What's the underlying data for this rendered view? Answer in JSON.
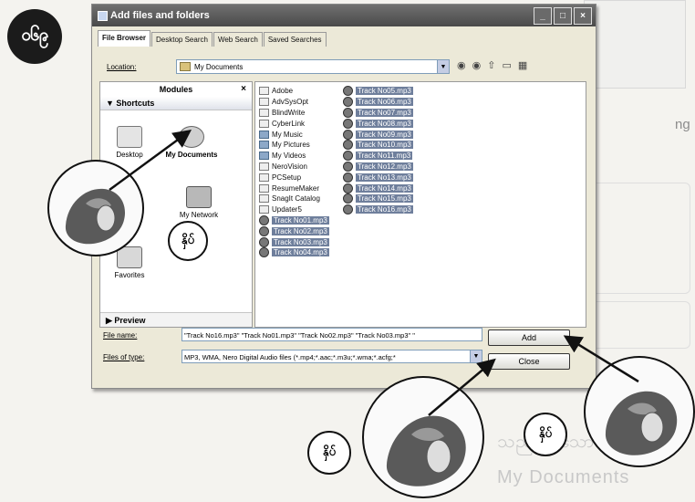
{
  "badge": {
    "text": "ဝ၆၉"
  },
  "page_bg": {
    "side_text": "ng",
    "bottom_line_1": "သည်ဖြစ်သော",
    "bottom_line_2": "My Documents"
  },
  "dialog": {
    "title": "Add files and folders",
    "tabs": [
      {
        "label": "File Browser"
      },
      {
        "label": "Desktop Search"
      },
      {
        "label": "Web Search"
      },
      {
        "label": "Saved Searches"
      }
    ],
    "location_label": "Location:",
    "location_value": "My Documents",
    "modules": {
      "title": "Modules",
      "close": "×",
      "shortcuts_label": "Shortcuts",
      "items": [
        {
          "label": "Desktop"
        },
        {
          "label": "My Documents"
        },
        {
          "label": "My Network"
        },
        {
          "label": "Favorites"
        }
      ],
      "preview_label": "Preview"
    },
    "files_col1": [
      {
        "name": "Adobe",
        "kind": "folder"
      },
      {
        "name": "AdvSysOpt",
        "kind": "folder"
      },
      {
        "name": "BlindWrite",
        "kind": "folder"
      },
      {
        "name": "CyberLink",
        "kind": "folder"
      },
      {
        "name": "My Music",
        "kind": "media"
      },
      {
        "name": "My Pictures",
        "kind": "media"
      },
      {
        "name": "My Videos",
        "kind": "media"
      },
      {
        "name": "NeroVision",
        "kind": "folder"
      },
      {
        "name": "PCSetup",
        "kind": "folder"
      },
      {
        "name": "ResumeMaker",
        "kind": "folder"
      },
      {
        "name": "SnagIt Catalog",
        "kind": "folder"
      },
      {
        "name": "Updater5",
        "kind": "folder"
      },
      {
        "name": "Track No01.mp3",
        "kind": "mp3"
      },
      {
        "name": "Track No02.mp3",
        "kind": "mp3"
      },
      {
        "name": "Track No03.mp3",
        "kind": "mp3"
      },
      {
        "name": "Track No04.mp3",
        "kind": "mp3"
      }
    ],
    "files_col2": [
      {
        "name": "Track No05.mp3",
        "kind": "mp3"
      },
      {
        "name": "Track No06.mp3",
        "kind": "mp3"
      },
      {
        "name": "Track No07.mp3",
        "kind": "mp3"
      },
      {
        "name": "Track No08.mp3",
        "kind": "mp3"
      },
      {
        "name": "Track No09.mp3",
        "kind": "mp3"
      },
      {
        "name": "Track No10.mp3",
        "kind": "mp3"
      },
      {
        "name": "Track No11.mp3",
        "kind": "mp3"
      },
      {
        "name": "Track No12.mp3",
        "kind": "mp3"
      },
      {
        "name": "Track No13.mp3",
        "kind": "mp3"
      },
      {
        "name": "Track No14.mp3",
        "kind": "mp3"
      },
      {
        "name": "Track No15.mp3",
        "kind": "mp3"
      },
      {
        "name": "Track No16.mp3",
        "kind": "mp3"
      }
    ],
    "filename_label": "File name:",
    "filename_value": "\"Track No16.mp3\" \"Track No01.mp3\" \"Track No02.mp3\" \"Track No03.mp3\" \"",
    "filetype_label": "Files of type:",
    "filetype_value": "MP3, WMA, Nero Digital Audio files (*.mp4;*.aac;*.m3u;*.wma;*.acfg;*",
    "add_button": "Add",
    "close_button": "Close"
  },
  "annotations": {
    "click_label": "နှိပ်"
  },
  "colors": {
    "titlebar": "#4a4a4a",
    "selection": "#6f7f9c",
    "dialog_bg": "#ece9d8"
  }
}
